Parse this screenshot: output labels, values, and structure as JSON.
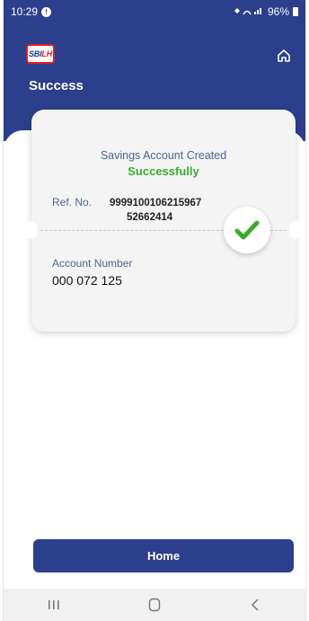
{
  "status_bar": {
    "time": "10:29",
    "notification_badge": "!",
    "signal_icons": "¥≐.ᴵᴵ",
    "battery_percent": "96%"
  },
  "header": {
    "logo": {
      "text_main": "SBI",
      "text_accent": "LH",
      "brand_color": "#1b3a8a",
      "accent_color": "#e31e24"
    },
    "title": "Success",
    "home_icon": "home-icon",
    "header_color": "#2c3f8d"
  },
  "card": {
    "headline": "Savings Account Created",
    "status": "Successfully",
    "ref_label": "Ref. No.",
    "ref_value_line1": "9999100106215967",
    "ref_value_line2": "52662414",
    "account_label": "Account Number",
    "account_number": "000 072 125",
    "success_color": "#3bab2e",
    "check_icon": "check-icon"
  },
  "footer": {
    "home_button_label": "Home"
  },
  "nav": {
    "recents_icon": "recents-icon",
    "home_icon": "nav-home-icon",
    "back_icon": "back-icon"
  }
}
